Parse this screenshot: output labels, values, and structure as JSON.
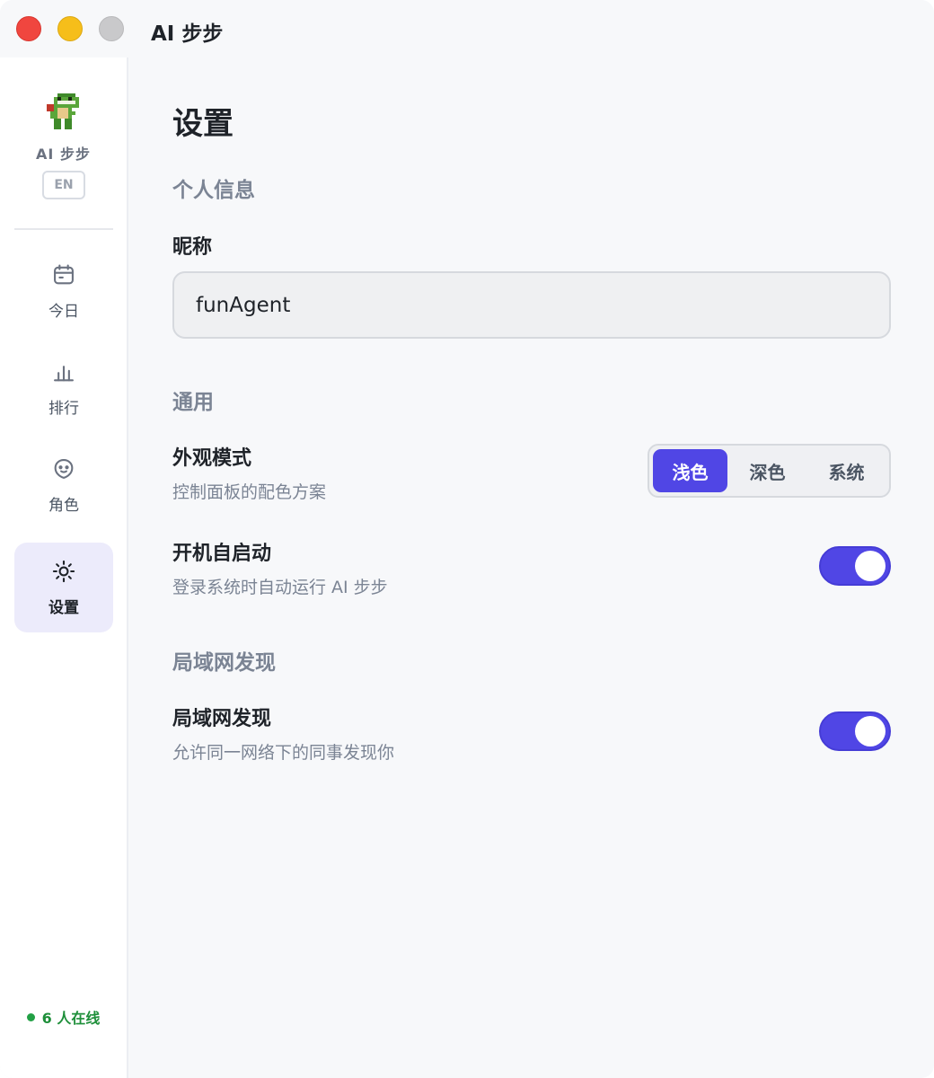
{
  "window": {
    "title": "AI 步步"
  },
  "sidebar": {
    "brand": "AI 步步",
    "lang_button": "EN",
    "items": [
      {
        "label": "今日",
        "icon": "calendar-icon"
      },
      {
        "label": "排行",
        "icon": "bar-chart-icon"
      },
      {
        "label": "角色",
        "icon": "face-icon"
      },
      {
        "label": "设置",
        "icon": "sun-gear-icon",
        "active": true
      }
    ],
    "online_status": "6 人在线"
  },
  "main": {
    "title": "设置",
    "profile": {
      "section_title": "个人信息",
      "nickname_label": "昵称",
      "nickname_value": "funAgent"
    },
    "general": {
      "section_title": "通用",
      "appearance": {
        "title": "外观模式",
        "desc": "控制面板的配色方案",
        "options": [
          "浅色",
          "深色",
          "系统"
        ],
        "selected": "浅色"
      },
      "autostart": {
        "title": "开机自启动",
        "desc": "登录系统时自动运行 AI 步步",
        "enabled": true
      }
    },
    "lan": {
      "section_title": "局域网发现",
      "discovery": {
        "title": "局域网发现",
        "desc": "允许同一网络下的同事发现你",
        "enabled": true
      }
    }
  },
  "colors": {
    "accent": "#5046e5",
    "online": "#22a045"
  }
}
